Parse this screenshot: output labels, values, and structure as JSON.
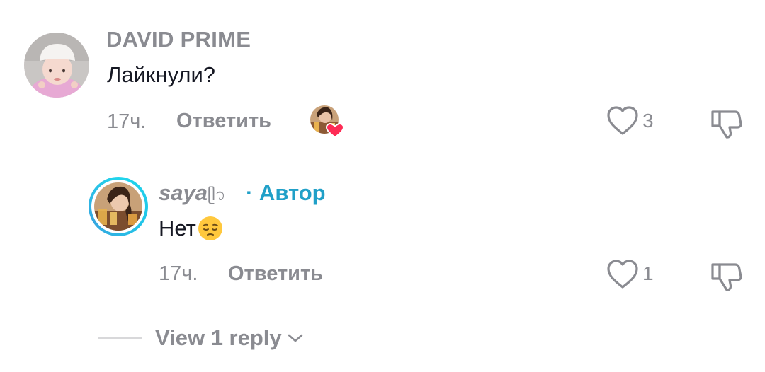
{
  "comment": {
    "username": "DAVID PRIME",
    "text": "Лайкнули?",
    "time": "17ч.",
    "reply_label": "Ответить",
    "likes": "3",
    "avatar_icon": "baby-photo-avatar",
    "liked_by_icon": "creator-liked-heart"
  },
  "reply": {
    "username": "saya",
    "username_suffix": "ᥫ᭡",
    "badge": "· Автор",
    "text": "Нет",
    "emoji": "pensive-face-emoji",
    "time": "17ч.",
    "reply_label": "Ответить",
    "likes": "1",
    "avatar_icon": "girl-photo-avatar"
  },
  "view_replies": {
    "label": "View 1 reply"
  },
  "colors": {
    "muted": "#8a8b91",
    "text": "#161823",
    "author": "#20a0c8",
    "ring": "#20d5ec",
    "like_heart": "#fe2c55"
  }
}
